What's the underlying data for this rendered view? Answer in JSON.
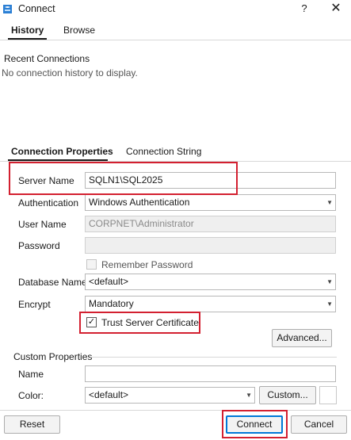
{
  "window": {
    "title": "Connect",
    "help_glyph": "?",
    "close_glyph": "✕"
  },
  "top_tabs": [
    {
      "label": "History",
      "active": true
    },
    {
      "label": "Browse",
      "active": false
    }
  ],
  "history": {
    "heading": "Recent Connections",
    "empty_text": "No connection history to display."
  },
  "props_tabs": [
    {
      "label": "Connection Properties",
      "active": true
    },
    {
      "label": "Connection String",
      "active": false
    }
  ],
  "form": {
    "server_name": {
      "label": "Server Name",
      "value": "SQLN1\\SQL2025"
    },
    "authentication": {
      "label": "Authentication",
      "value": "Windows Authentication"
    },
    "user_name": {
      "label": "User Name",
      "value": "CORPNET\\Administrator"
    },
    "password": {
      "label": "Password",
      "value": ""
    },
    "remember_password": {
      "label": "Remember Password",
      "checked": false
    },
    "database_name": {
      "label": "Database Name",
      "value": "<default>"
    },
    "encrypt": {
      "label": "Encrypt",
      "value": "Mandatory"
    },
    "trust_server_certificate": {
      "label": "Trust Server Certificate",
      "checked": true,
      "check_glyph": "✓"
    },
    "advanced_label": "Advanced..."
  },
  "custom": {
    "heading": "Custom Properties",
    "name": {
      "label": "Name",
      "value": ""
    },
    "color": {
      "label": "Color:",
      "value": "<default>",
      "custom_label": "Custom..."
    }
  },
  "footer": {
    "reset_label": "Reset",
    "connect_label": "Connect",
    "cancel_label": "Cancel"
  },
  "colors": {
    "highlight_box": "#d32030",
    "default_button_border": "#0078d7"
  },
  "icons": {
    "app": "ssms-app-icon",
    "dropdown": "chevron-down-icon"
  }
}
